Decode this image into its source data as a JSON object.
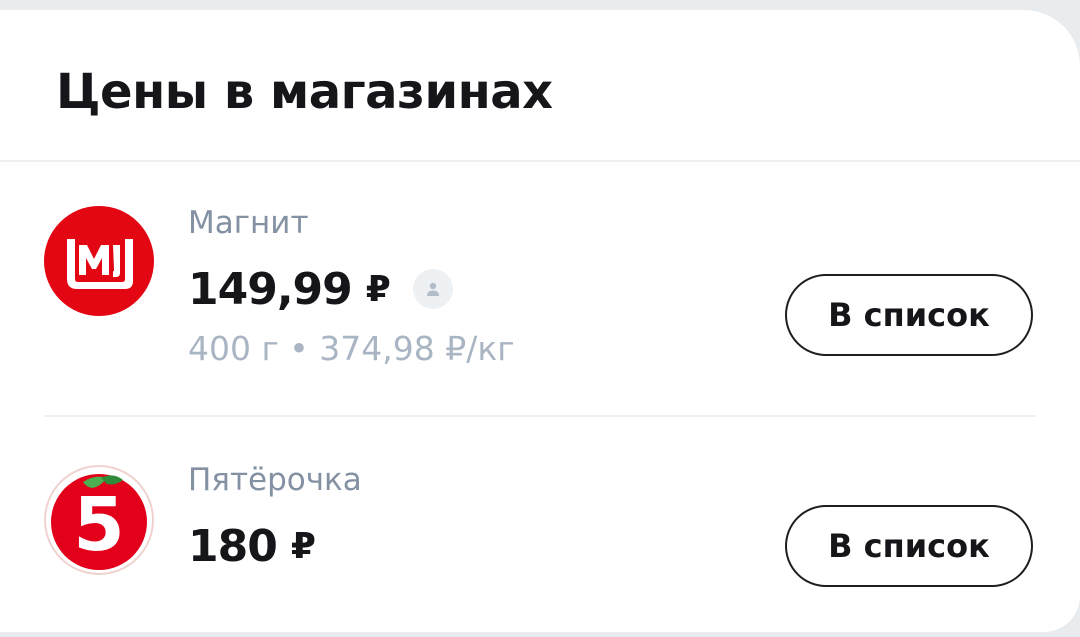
{
  "section": {
    "title": "Цены в магазинах"
  },
  "stores": [
    {
      "name": "Магнит",
      "price": "149,99",
      "currency": "₽",
      "unit_price": "400 г • 374,98 ₽/кг",
      "button_label": "В список",
      "logo": "magnit-logo",
      "brand_color": "#e30613"
    },
    {
      "name": "Пятёрочка",
      "price": "180",
      "currency": "₽",
      "button_label": "В список",
      "logo": "pyaterochka-logo",
      "brand_color": "#e2001a"
    }
  ],
  "colors": {
    "text_primary": "#16161a",
    "text_secondary": "#8391a3",
    "text_tertiary": "#aab5c3",
    "divider": "#eceef1",
    "background": "#e9ecef"
  },
  "icons": {
    "price_author": "user-icon"
  }
}
